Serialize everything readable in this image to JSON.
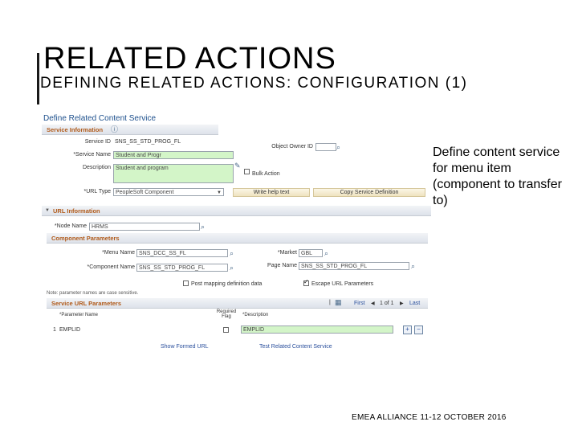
{
  "slide": {
    "title": "RELATED ACTIONS",
    "subtitle": "DEFINING RELATED ACTIONS: CONFIGURATION (1)",
    "side_note": "Define content service for menu item (component to transfer to)",
    "footer": "EMEA ALLIANCE   11-12 OCTOBER 2016"
  },
  "screen": {
    "page_title": "Define Related Content Service",
    "service_info": {
      "header": "Service Information",
      "service_id_label": "Service ID",
      "service_id_value": "SNS_SS_STD_PROG_FL",
      "object_owner_label": "Object Owner ID",
      "service_name_label": "*Service Name",
      "service_name_value": "Student and Progr",
      "description_label": "Description",
      "description_value": "Student and program",
      "bulk_action_label": "Bulk Action",
      "url_type_label": "*URL Type",
      "url_type_value": "PeopleSoft Component",
      "write_help_label": "Write help text",
      "copy_service_label": "Copy Service Definition"
    },
    "url_info": {
      "header": "URL Information",
      "node_name_label": "*Node Name",
      "node_name_value": "HRMS"
    },
    "component_params": {
      "header": "Component Parameters",
      "menu_name_label": "*Menu Name",
      "menu_name_value": "SNS_DCC_SS_FL",
      "market_label": "*Market",
      "market_value": "GBL",
      "component_name_label": "*Component Name",
      "component_name_value": "SNS_SS_STD_PROG_FL",
      "page_name_label": "Page Name",
      "page_name_value": "SNS_SS_STD_PROG_FL",
      "post_mapping_label": "Post mapping definition data",
      "escape_url_label": "Escape URL Parameters"
    },
    "note": "Note: parameter names are case sensitive.",
    "service_url_params": {
      "header": "Service URL Parameters",
      "first_label": "First",
      "page_indicator": "1 of 1",
      "last_label": "Last",
      "col_param_name": "*Parameter Name",
      "col_required_line1": "Required",
      "col_required_line2": "Flag",
      "col_description": "*Description",
      "row_index": "1",
      "row_param_name": "EMPLID",
      "row_description": "EMPLID"
    },
    "show_url_label": "Show Formed URL",
    "test_service_label": "Test Related Content Service"
  }
}
